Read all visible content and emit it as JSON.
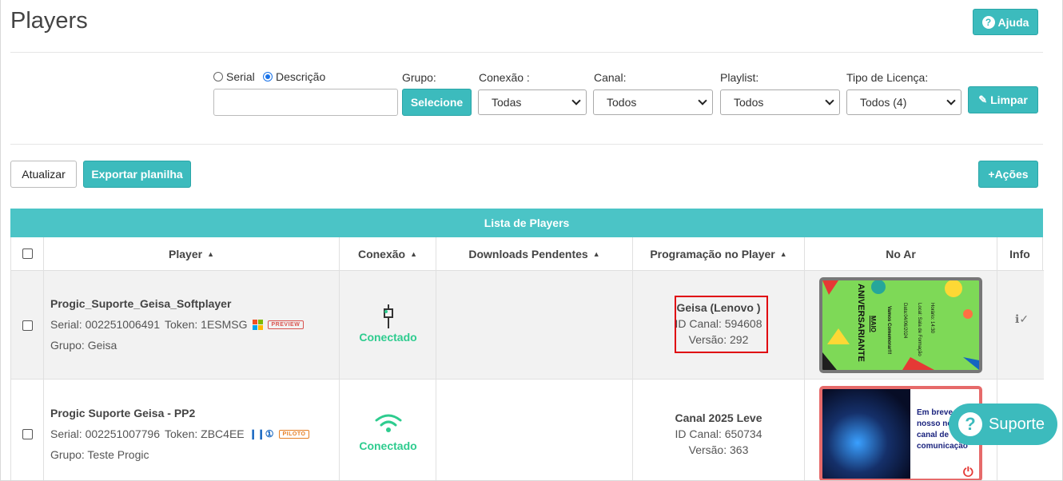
{
  "page": {
    "title": "Players"
  },
  "header": {
    "help_label": "Ajuda"
  },
  "filters": {
    "radio_serial": "Serial",
    "radio_descricao": "Descrição",
    "grupo_label": "Grupo:",
    "grupo_button": "Selecione",
    "conexao_label": "Conexão :",
    "conexao_value": "Todas",
    "canal_label": "Canal:",
    "canal_value": "Todos",
    "playlist_label": "Playlist:",
    "playlist_value": "Todos",
    "licenca_label": "Tipo de Licença:",
    "licenca_value": "Todos (4)",
    "clear_label": "Limpar"
  },
  "actions": {
    "refresh": "Atualizar",
    "export": "Exportar planilha",
    "more": "+Ações"
  },
  "table": {
    "caption": "Lista de Players",
    "columns": [
      "Player",
      "Conexão",
      "Downloads Pendentes",
      "Programação no Player",
      "No Ar",
      "Info"
    ],
    "rows": [
      {
        "name": "Progic_Suporte_Geisa_Softplayer",
        "serial": "Serial: 002251006491",
        "token": "Token: 1ESMSG",
        "badge": "PREVIEW",
        "group": "Grupo: Geisa",
        "connection": "Conectado",
        "channel": "Geisa (Lenovo )",
        "channel_id": "ID Canal: 594608",
        "version": "Versão: 292",
        "thumb_title": "ANIVERSARIANTE",
        "thumb_sub": "MAIO",
        "thumb_line1": "Vamos Comemorar!!!",
        "thumb_line2": "Data:04/06/2024",
        "thumb_line3": "Local: Sala de Formação",
        "thumb_line4": "Horário: 14:30"
      },
      {
        "name": "Progic Suporte Geisa - PP2",
        "serial": "Serial: 002251007796",
        "token": "Token: ZBC4EE",
        "badge": "PILOTO",
        "group": "Grupo: Teste Progic",
        "connection": "Conectado",
        "channel": "Canal 2025 Leve",
        "channel_id": "ID Canal: 650734",
        "version": "Versão: 363",
        "thumb_line1": "Em breve",
        "thumb_line2": "nosso no",
        "thumb_line3": "canal de",
        "thumb_line4": "comunicação"
      }
    ]
  },
  "support": {
    "label": "Suporte"
  },
  "colors": {
    "teal": "#3cbbbd",
    "header_teal": "#4bc4c6",
    "connected": "#2ecc8f",
    "highlight": "#e0000f"
  }
}
